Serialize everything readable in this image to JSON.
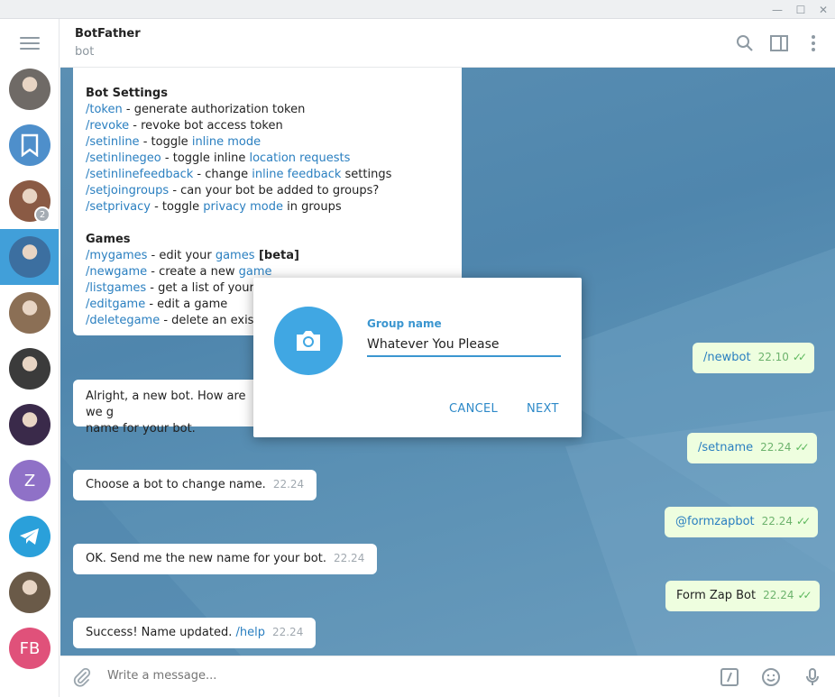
{
  "window": {
    "minimize_glyph": "—",
    "maximize_glyph": "☐",
    "close_glyph": "✕"
  },
  "rail": {
    "chats": [
      {
        "kind": "photo",
        "color": "#6f6a66"
      },
      {
        "kind": "saved",
        "color": "#4e8fcb"
      },
      {
        "kind": "photo",
        "color": "#8a5a44",
        "badge": "2"
      },
      {
        "kind": "photo",
        "color": "#3c6fa0",
        "active": true
      },
      {
        "kind": "photo",
        "color": "#8b6f55"
      },
      {
        "kind": "photo",
        "color": "#3b3b3b"
      },
      {
        "kind": "photo",
        "color": "#3a2a4a"
      },
      {
        "kind": "letter",
        "letter": "Z",
        "color": "#8f71c7"
      },
      {
        "kind": "telegram",
        "color": "#2aa0da"
      },
      {
        "kind": "photo",
        "color": "#6a5a48"
      },
      {
        "kind": "letter",
        "letter": "FB",
        "color": "#e0517a"
      }
    ]
  },
  "header": {
    "name": "BotFather",
    "status": "bot"
  },
  "chat": {
    "help": {
      "section1": "Bot Settings",
      "lines1": [
        {
          "cmd": "/token",
          "rest": " - generate authorization token"
        },
        {
          "cmd": "/revoke",
          "rest": " - revoke bot access token"
        },
        {
          "cmd": "/setinline",
          "rest": " - toggle ",
          "link": "inline mode"
        },
        {
          "cmd": "/setinlinegeo",
          "rest": " - toggle inline ",
          "link": "location requests"
        },
        {
          "cmd": "/setinlinefeedback",
          "rest": " - change ",
          "link": "inline feedback",
          "tail": " settings"
        },
        {
          "cmd": "/setjoingroups",
          "rest": " - can your bot be added to groups?"
        },
        {
          "cmd": "/setprivacy",
          "rest": " - toggle ",
          "link": "privacy mode",
          "tail": " in groups"
        }
      ],
      "section2": "Games",
      "lines2": [
        {
          "cmd": "/mygames",
          "rest": " - edit your ",
          "link": "games",
          "tail": " [beta]"
        },
        {
          "cmd": "/newgame",
          "rest": " - create a new ",
          "link": "game"
        },
        {
          "cmd": "/listgames",
          "rest": " - get a list of your gar"
        },
        {
          "cmd": "/editgame",
          "rest": " - edit a game"
        },
        {
          "cmd": "/deletegame",
          "rest": " - delete an existing"
        }
      ]
    },
    "messages": [
      {
        "id": "out1",
        "text": "/newbot",
        "time": "22.10"
      },
      {
        "id": "in1",
        "text": "Alright, a new bot. How are we g",
        "text2": "name for your bot."
      },
      {
        "id": "out2",
        "text": "/setname",
        "time": "22.24"
      },
      {
        "id": "in2",
        "text": "Choose a bot to change name.",
        "time": "22.24"
      },
      {
        "id": "out3",
        "text": "@formzapbot",
        "time": "22.24"
      },
      {
        "id": "in3",
        "text": "OK. Send me the new name for your bot.",
        "time": "22.24"
      },
      {
        "id": "out4",
        "text": "Form Zap Bot",
        "time": "22.24"
      },
      {
        "id": "in4",
        "text": "Success! Name updated. ",
        "link": "/help",
        "time": "22.24"
      }
    ]
  },
  "composer": {
    "placeholder": "Write a message..."
  },
  "dialog": {
    "field_label": "Group name",
    "field_value": "Whatever You Please",
    "cancel_label": "CANCEL",
    "next_label": "NEXT",
    "accent": "#40a7e3"
  }
}
